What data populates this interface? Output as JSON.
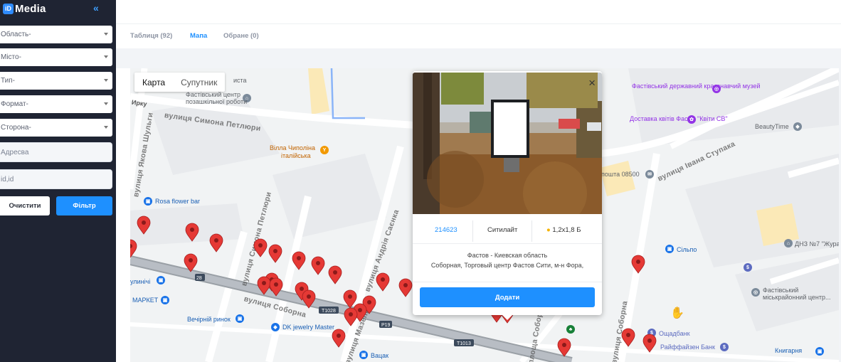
{
  "brand": {
    "badge": "iD",
    "name": "Media",
    "collapse_icon": "«"
  },
  "filters": {
    "oblast": "Область-",
    "city": "Місто-",
    "type": "Тип-",
    "format": "Формат-",
    "side": "Сторона-",
    "address_placeholder": "Адресва",
    "id_placeholder": "id,id",
    "clear_label": "Очистити",
    "filter_label": "Фільтр"
  },
  "tabs": [
    {
      "label": "Таблиця (92)",
      "active": false
    },
    {
      "label": "Мапа",
      "active": true
    },
    {
      "label": "Обране (0)",
      "active": false
    }
  ],
  "map": {
    "type_map": "Карта",
    "type_satellite": "Супутник",
    "streets": [
      "вулиця Симона Петлюри",
      "вулиця Андрія Саєнка",
      "вулиця Соборна",
      "вулиця Івана Ступака",
      "вулиця Симона Петлюри",
      "вулиця Мазепи",
      "площа Соборна",
      "вулиця Соборна",
      "вулиця Якова Шульги"
    ],
    "pois": [
      "Фастівський центр позашкільної роботи",
      "Вілла Чиполіна",
      "італійська",
      "Rosa flower bar",
      "Фастівський державний краєзнавчий музей",
      "Доставка квітів Фастів \"Квіти СВ\"",
      "BeautyTime",
      "пошта 08500",
      "Сільпо",
      "ДНЗ №7 \"Жура",
      "Фастівський міськрайонний центр...",
      "Ощадбанк",
      "Райффайзен Банк",
      "Книгарня",
      "МАРКЕТ",
      "Вечірній ринок",
      "DK jewelry Master",
      "Вацак",
      "улинічі",
      "Ирку",
      "иста"
    ],
    "route_labels": [
      "T1028",
      "P19",
      "T1013",
      "28"
    ],
    "marker_color": "#e53935",
    "accent_color": "#1e90ff"
  },
  "popup": {
    "close_icon": "×",
    "id": "214623",
    "type": "Ситилайт",
    "size": "1,2х1,8 Б",
    "city_line": "Фастов - Киевская область",
    "address_line": "Соборная, Торговый центр Фастов Сити, м-н Фора,",
    "add_label": "Додати"
  }
}
